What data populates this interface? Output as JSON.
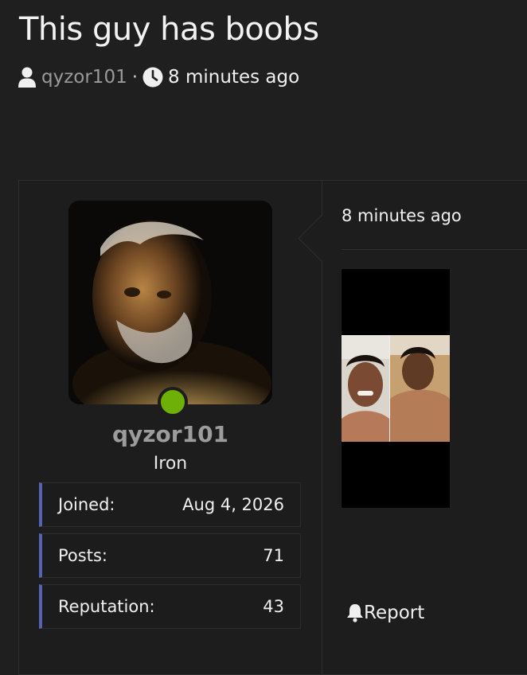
{
  "thread": {
    "title": "This guy has boobs",
    "author": "qyzor101",
    "separator": "·",
    "posted": "8 minutes ago"
  },
  "post": {
    "author": {
      "username": "qyzor101",
      "rank": "Iron",
      "online_status_color": "#6fb007",
      "stats": [
        {
          "label": "Joined:",
          "value": "Aug 4, 2026"
        },
        {
          "label": "Posts:",
          "value": "71"
        },
        {
          "label": "Reputation:",
          "value": "43"
        }
      ]
    },
    "timestamp": "8 minutes ago",
    "report_label": "Report"
  },
  "icons": {
    "author": "user-icon",
    "time": "clock-icon",
    "report": "bell-icon"
  },
  "colors": {
    "background": "#1f1f1f",
    "stat_accent": "#5262b5",
    "muted_text": "#9c9c9c"
  }
}
